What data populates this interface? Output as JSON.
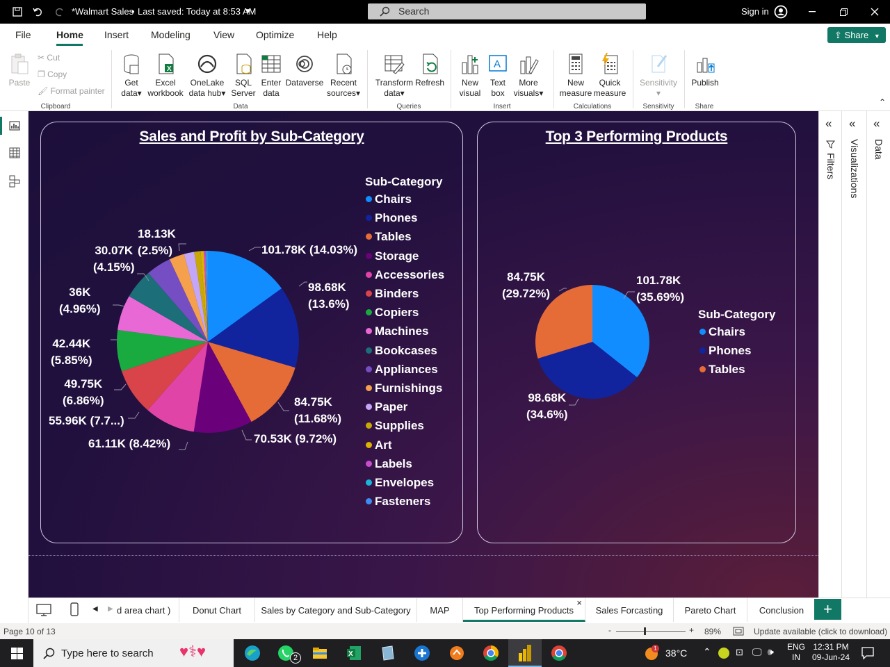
{
  "titlebar": {
    "file_title": "*Walmart Sales",
    "saved_status": "Last saved: Today at 8:53 AM",
    "search_placeholder": "Search",
    "sign_in": "Sign in"
  },
  "menu": {
    "items": [
      "File",
      "Home",
      "Insert",
      "Modeling",
      "View",
      "Optimize",
      "Help"
    ],
    "active": "Home",
    "share_label": "Share"
  },
  "ribbon": {
    "clipboard": {
      "paste": "Paste",
      "cut": "Cut",
      "copy": "Copy",
      "format_painter": "Format painter",
      "group": "Clipboard"
    },
    "data": {
      "get_data": [
        "Get",
        "data"
      ],
      "excel": [
        "Excel",
        "workbook"
      ],
      "onelake": [
        "OneLake",
        "data hub"
      ],
      "sql": [
        "SQL",
        "Server"
      ],
      "enter": [
        "Enter",
        "data"
      ],
      "dataverse": [
        "Dataverse",
        ""
      ],
      "recent": [
        "Recent",
        "sources"
      ],
      "group": "Data"
    },
    "queries": {
      "transform": [
        "Transform",
        "data"
      ],
      "refresh": [
        "Refresh",
        ""
      ],
      "group": "Queries"
    },
    "insert": {
      "new_visual": [
        "New",
        "visual"
      ],
      "text_box": [
        "Text",
        "box"
      ],
      "more_visuals": [
        "More",
        "visuals"
      ],
      "group": "Insert"
    },
    "calculations": {
      "new_measure": [
        "New",
        "measure"
      ],
      "quick_measure": [
        "Quick",
        "measure"
      ],
      "group": "Calculations"
    },
    "sensitivity": {
      "label": "Sensitivity",
      "group": "Sensitivity"
    },
    "share": {
      "publish": "Publish",
      "group": "Share"
    }
  },
  "panes": {
    "filters": "Filters",
    "visualizations": "Visualizations",
    "data": "Data"
  },
  "chart_data": [
    {
      "type": "pie",
      "title": "Sales and Profit by Sub-Category",
      "legend_title": "Sub-Category",
      "legend_position": "right",
      "categories": [
        "Chairs",
        "Phones",
        "Tables",
        "Storage",
        "Accessories",
        "Binders",
        "Copiers",
        "Machines",
        "Bookcases",
        "Appliances",
        "Furnishings",
        "Paper",
        "Supplies",
        "Art",
        "Labels",
        "Envelopes",
        "Fasteners"
      ],
      "values": [
        101.78,
        98.68,
        84.75,
        70.53,
        61.11,
        55.96,
        49.75,
        42.44,
        36,
        30.07,
        18.13,
        12.4,
        7.6,
        3.8,
        2.2,
        1.6,
        1.1
      ],
      "colors": [
        "#118DFF",
        "#12239E",
        "#E66C37",
        "#6B007B",
        "#E044A7",
        "#D9444A",
        "#1AAB40",
        "#E869D5",
        "#1C6E78",
        "#744EC2",
        "#F5A04D",
        "#C4A6F8",
        "#C8A807",
        "#DDB202",
        "#CA4BCE",
        "#1AB6D9",
        "#3E8DF2"
      ],
      "data_labels": [
        [
          "101.78K (14.03%)"
        ],
        [
          "98.68K",
          "(13.6%)"
        ],
        [
          "84.75K",
          "(11.68%)"
        ],
        [
          "70.53K (9.72%)"
        ],
        [
          "61.11K (8.42%)"
        ],
        [
          "55.96K (7.7...)"
        ],
        [
          "49.75K",
          "(6.86%)"
        ],
        [
          "42.44K",
          "(5.85%)"
        ],
        [
          "36K",
          "(4.96%)"
        ],
        [
          "30.07K",
          "(4.15%)"
        ],
        [
          "18.13K",
          "(2.5%)"
        ]
      ]
    },
    {
      "type": "pie",
      "title": "Top 3 Performing Products",
      "legend_title": "Sub-Category",
      "legend_position": "right",
      "categories": [
        "Chairs",
        "Phones",
        "Tables"
      ],
      "values": [
        101.78,
        98.68,
        84.75
      ],
      "colors": [
        "#118DFF",
        "#12239E",
        "#E66C37"
      ],
      "data_labels": [
        [
          "101.78K",
          "(35.69%)"
        ],
        [
          "98.68K",
          "(34.6%)"
        ],
        [
          "84.75K",
          "(29.72%)"
        ]
      ]
    }
  ],
  "tabs": {
    "items": [
      "d area chart )",
      "Donut Chart",
      "Sales by Category and Sub-Category",
      "MAP",
      "Top Performing Products",
      "Sales Forcasting",
      "Pareto Chart",
      "Conclusion"
    ],
    "active": "Top Performing Products",
    "close": "×",
    "add": "+"
  },
  "status": {
    "page": "Page 10 of 13",
    "zoom": "89%",
    "update": "Update available (click to download)"
  },
  "taskbar": {
    "search_placeholder": "Type here to search",
    "whatsapp_badge": "2",
    "weather_badge": "1",
    "temperature": "38°C",
    "lang": [
      "ENG",
      "IN"
    ],
    "time": "12:31 PM",
    "date": "09-Jun-24"
  }
}
